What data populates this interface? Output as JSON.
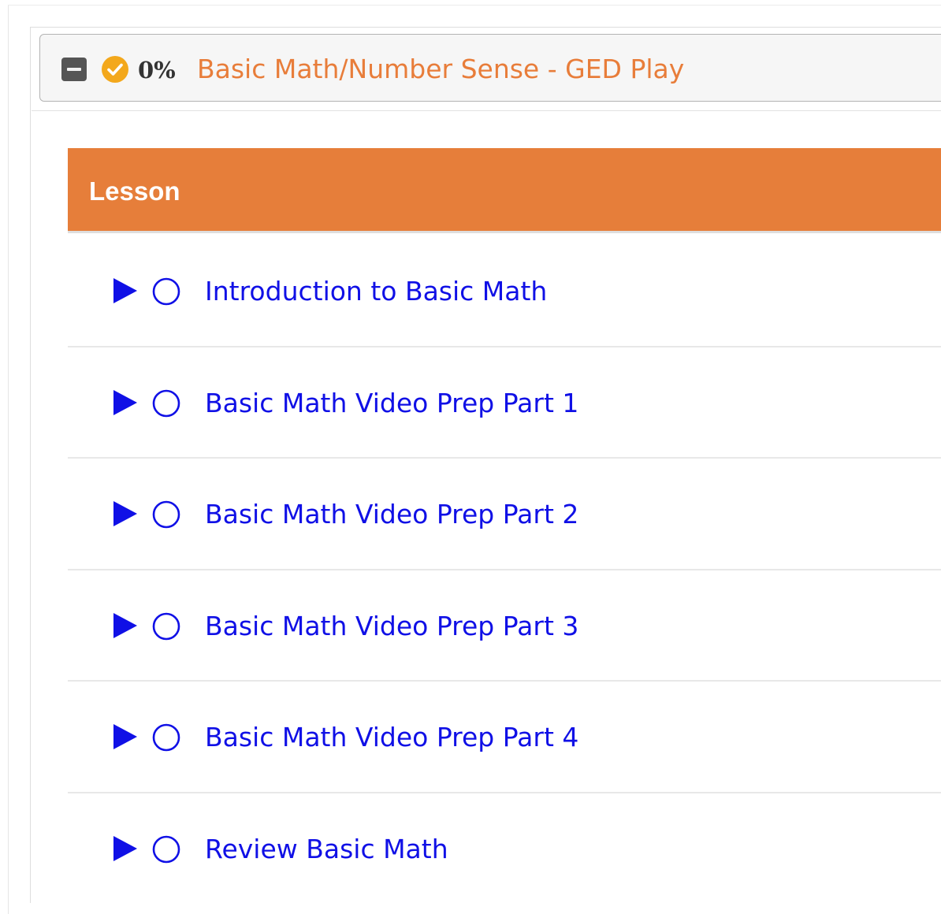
{
  "course": {
    "toggle_icon": "minus-square-icon",
    "status_icon": "check-circle-icon",
    "progress": "0%",
    "title": "Basic Math/Number Sense - GED Play",
    "title_color": "#e87d3a"
  },
  "table": {
    "header_label": "Lesson",
    "header_color": "#e67e3a"
  },
  "lessons": [
    {
      "title": "Introduction to Basic Math",
      "play_icon": "play-icon",
      "status_icon": "circle-outline-icon"
    },
    {
      "title": "Basic Math Video Prep Part 1",
      "play_icon": "play-icon",
      "status_icon": "circle-outline-icon"
    },
    {
      "title": "Basic Math Video Prep Part 2",
      "play_icon": "play-icon",
      "status_icon": "circle-outline-icon"
    },
    {
      "title": "Basic Math Video Prep Part 3",
      "play_icon": "play-icon",
      "status_icon": "circle-outline-icon"
    },
    {
      "title": "Basic Math Video Prep Part 4",
      "play_icon": "play-icon",
      "status_icon": "circle-outline-icon"
    },
    {
      "title": "Review Basic Math",
      "play_icon": "play-icon",
      "status_icon": "circle-outline-icon"
    }
  ],
  "colors": {
    "lesson_link": "#1010e6",
    "status_check": "#f3a81c"
  }
}
